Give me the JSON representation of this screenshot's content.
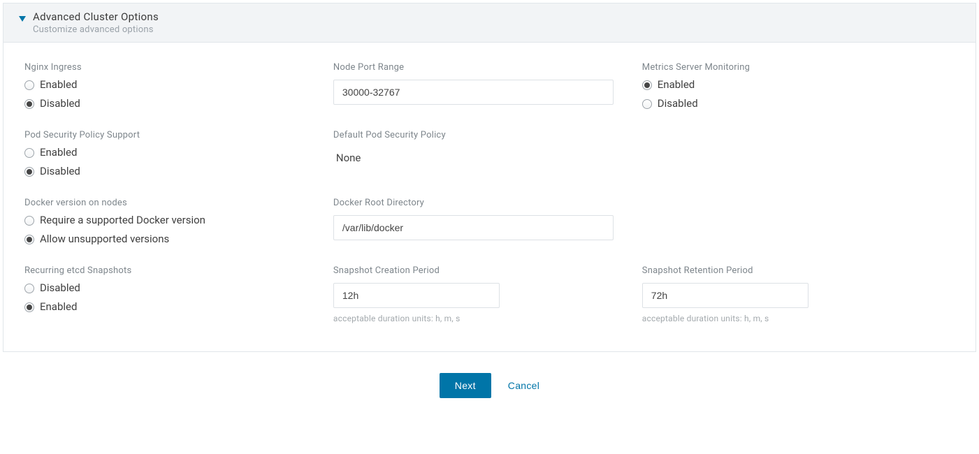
{
  "panel": {
    "title": "Advanced Cluster Options",
    "subtitle": "Customize advanced options"
  },
  "nginx_ingress": {
    "label": "Nginx Ingress",
    "options": {
      "enabled": "Enabled",
      "disabled": "Disabled"
    },
    "selected": "disabled"
  },
  "node_port_range": {
    "label": "Node Port Range",
    "value": "30000-32767"
  },
  "metrics_server": {
    "label": "Metrics Server Monitoring",
    "options": {
      "enabled": "Enabled",
      "disabled": "Disabled"
    },
    "selected": "enabled"
  },
  "pod_security": {
    "label": "Pod Security Policy Support",
    "options": {
      "enabled": "Enabled",
      "disabled": "Disabled"
    },
    "selected": "disabled"
  },
  "default_pod_policy": {
    "label": "Default Pod Security Policy",
    "value": "None"
  },
  "docker_version": {
    "label": "Docker version on nodes",
    "options": {
      "require": "Require a supported Docker version",
      "allow": "Allow unsupported versions"
    },
    "selected": "allow"
  },
  "docker_root": {
    "label": "Docker Root Directory",
    "value": "/var/lib/docker"
  },
  "etcd_snapshots": {
    "label": "Recurring etcd Snapshots",
    "options": {
      "disabled": "Disabled",
      "enabled": "Enabled"
    },
    "selected": "enabled"
  },
  "snapshot_creation": {
    "label": "Snapshot Creation Period",
    "value": "12h",
    "hint": "acceptable duration units: h, m, s"
  },
  "snapshot_retention": {
    "label": "Snapshot Retention Period",
    "value": "72h",
    "hint": "acceptable duration units: h, m, s"
  },
  "footer": {
    "next": "Next",
    "cancel": "Cancel"
  }
}
